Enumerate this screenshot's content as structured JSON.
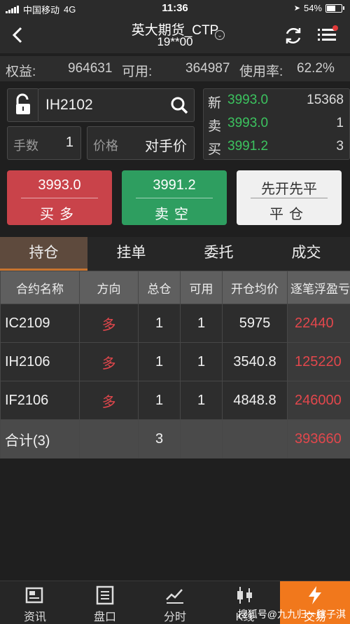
{
  "status": {
    "carrier": "中国移动",
    "network": "4G",
    "time": "11:36",
    "battery": "54%"
  },
  "nav": {
    "title": "英大期货_CTP",
    "subtitle": "19**00"
  },
  "account": {
    "equity_label": "权益:",
    "equity": "964631",
    "available_label": "可用:",
    "available": "364987",
    "usage_label": "使用率:",
    "usage": "62.2%"
  },
  "order": {
    "contract": "IH2102",
    "qty_label": "手数",
    "qty": "1",
    "price_label": "价格",
    "price_value": "对手价"
  },
  "quote": [
    {
      "label": "新",
      "price": "3993.0",
      "vol": "15368"
    },
    {
      "label": "卖",
      "price": "3993.0",
      "vol": "1"
    },
    {
      "label": "买",
      "price": "3991.2",
      "vol": "3"
    }
  ],
  "buttons": {
    "buy": {
      "price": "3993.0",
      "label": "买多"
    },
    "sell": {
      "price": "3991.2",
      "label": "卖空"
    },
    "close": {
      "top": "先开先平",
      "label": "平仓"
    }
  },
  "tabs": [
    "持仓",
    "挂单",
    "委托",
    "成交"
  ],
  "table": {
    "headers": [
      "合约名称",
      "方向",
      "总仓",
      "可用",
      "开仓均价",
      "逐笔浮盈亏"
    ],
    "rows": [
      [
        "IC2109",
        "多",
        "1",
        "1",
        "5975",
        "22440"
      ],
      [
        "IH2106",
        "多",
        "1",
        "1",
        "3540.8",
        "125220"
      ],
      [
        "IF2106",
        "多",
        "1",
        "1",
        "4848.8",
        "246000"
      ]
    ],
    "total": [
      "合计(3)",
      "",
      "3",
      "",
      "",
      "393660"
    ]
  },
  "bottom_nav": [
    "资讯",
    "盘口",
    "分时",
    "K线",
    "交易"
  ],
  "watermark": "搜狐号@九九归一稼子淇",
  "colors": {
    "buy": "#c9434a",
    "sell": "#2e9e60",
    "profit": "#e2474c",
    "active_tab": "#5e4a3d",
    "active_nav": "#f1781c"
  }
}
